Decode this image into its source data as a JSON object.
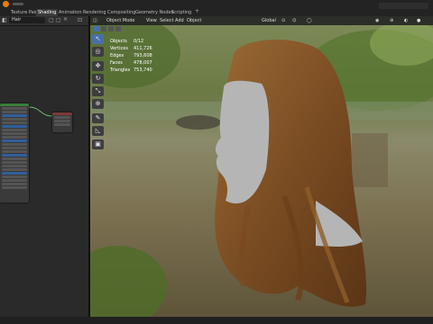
{
  "app": {
    "name": "Blender"
  },
  "tabs": [
    "Texture Paint",
    "Shading",
    "Animation",
    "Rendering",
    "Compositing",
    "Geometry Nodes",
    "Scripting"
  ],
  "active_tab": "Shading",
  "left_editor": {
    "material_field": "Hair"
  },
  "viewport": {
    "mode": "Object Mode",
    "menus": [
      "View",
      "Select",
      "Add",
      "Object"
    ],
    "transform_orientation": "Global"
  },
  "stats": [
    {
      "label": "Objects",
      "value": "0/12"
    },
    {
      "label": "Vertices",
      "value": "411,726"
    },
    {
      "label": "Edges",
      "value": "793,608"
    },
    {
      "label": "Faces",
      "value": "478,007"
    },
    {
      "label": "Triangles",
      "value": "753,740"
    }
  ],
  "tools": [
    {
      "icon": "select-cursor-icon",
      "glyph": "↖"
    },
    {
      "icon": "cursor-icon",
      "glyph": "◎"
    },
    {
      "icon": "move-icon",
      "glyph": "✥"
    },
    {
      "icon": "rotate-icon",
      "glyph": "↻"
    },
    {
      "icon": "scale-icon",
      "glyph": "⤡"
    },
    {
      "icon": "transform-icon",
      "glyph": "⊕"
    },
    {
      "icon": "annotate-icon",
      "glyph": "✎"
    },
    {
      "icon": "measure-icon",
      "glyph": "◺"
    },
    {
      "icon": "add-cube-icon",
      "glyph": "▣"
    }
  ],
  "colors": {
    "accent": "#4a6fa8",
    "hair": "#8a5a2b",
    "skin": "#b8b8b8"
  }
}
